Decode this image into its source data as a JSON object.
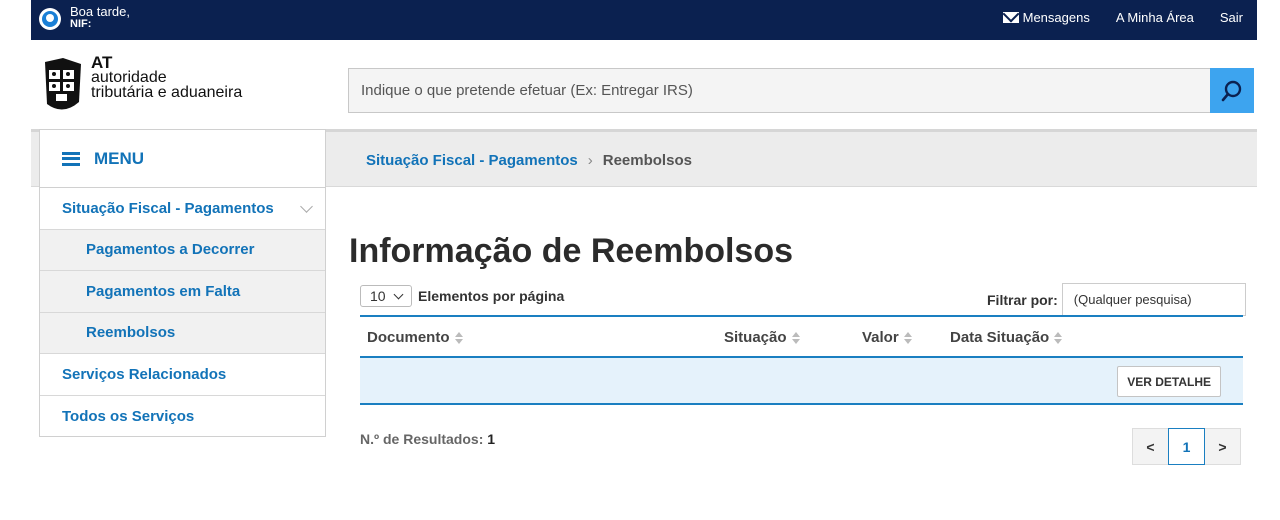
{
  "topbar": {
    "greeting": "Boa tarde,",
    "nif_label": "NIF:",
    "messages": "Mensagens",
    "my_area": "A Minha Área",
    "logout": "Sair"
  },
  "logo": {
    "abbr": "AT",
    "line1": "autoridade",
    "line2": "tributária e aduaneira"
  },
  "search": {
    "placeholder": "Indique o que pretende efetuar (Ex: Entregar IRS)"
  },
  "breadcrumb": {
    "items": [
      "Situação Fiscal - Pagamentos",
      "Reembolsos"
    ],
    "separator": "›"
  },
  "sidebar": {
    "menu_label": "MENU",
    "items": [
      {
        "label": "Situação Fiscal - Pagamentos"
      },
      {
        "label": "Pagamentos a Decorrer"
      },
      {
        "label": "Pagamentos em Falta"
      },
      {
        "label": "Reembolsos"
      },
      {
        "label": "Serviços Relacionados"
      },
      {
        "label": "Todos os Serviços"
      }
    ]
  },
  "main": {
    "title": "Informação de Reembolsos",
    "page_size": "10",
    "page_size_label": "Elementos por página",
    "filter_label": "Filtrar por:",
    "filter_placeholder": "(Qualquer pesquisa)",
    "columns": [
      "Documento",
      "Situação",
      "Valor",
      "Data Situação"
    ],
    "row_button": "VER DETALHE",
    "results_label": "N.º de Resultados:",
    "results_count": "1"
  },
  "pagination": {
    "prev": "<",
    "current": "1",
    "next": ">"
  },
  "colors": {
    "topbar": "#0b2150",
    "link": "#1273b8",
    "accent": "#3da4ef",
    "row_bg": "#e5f2fb"
  }
}
